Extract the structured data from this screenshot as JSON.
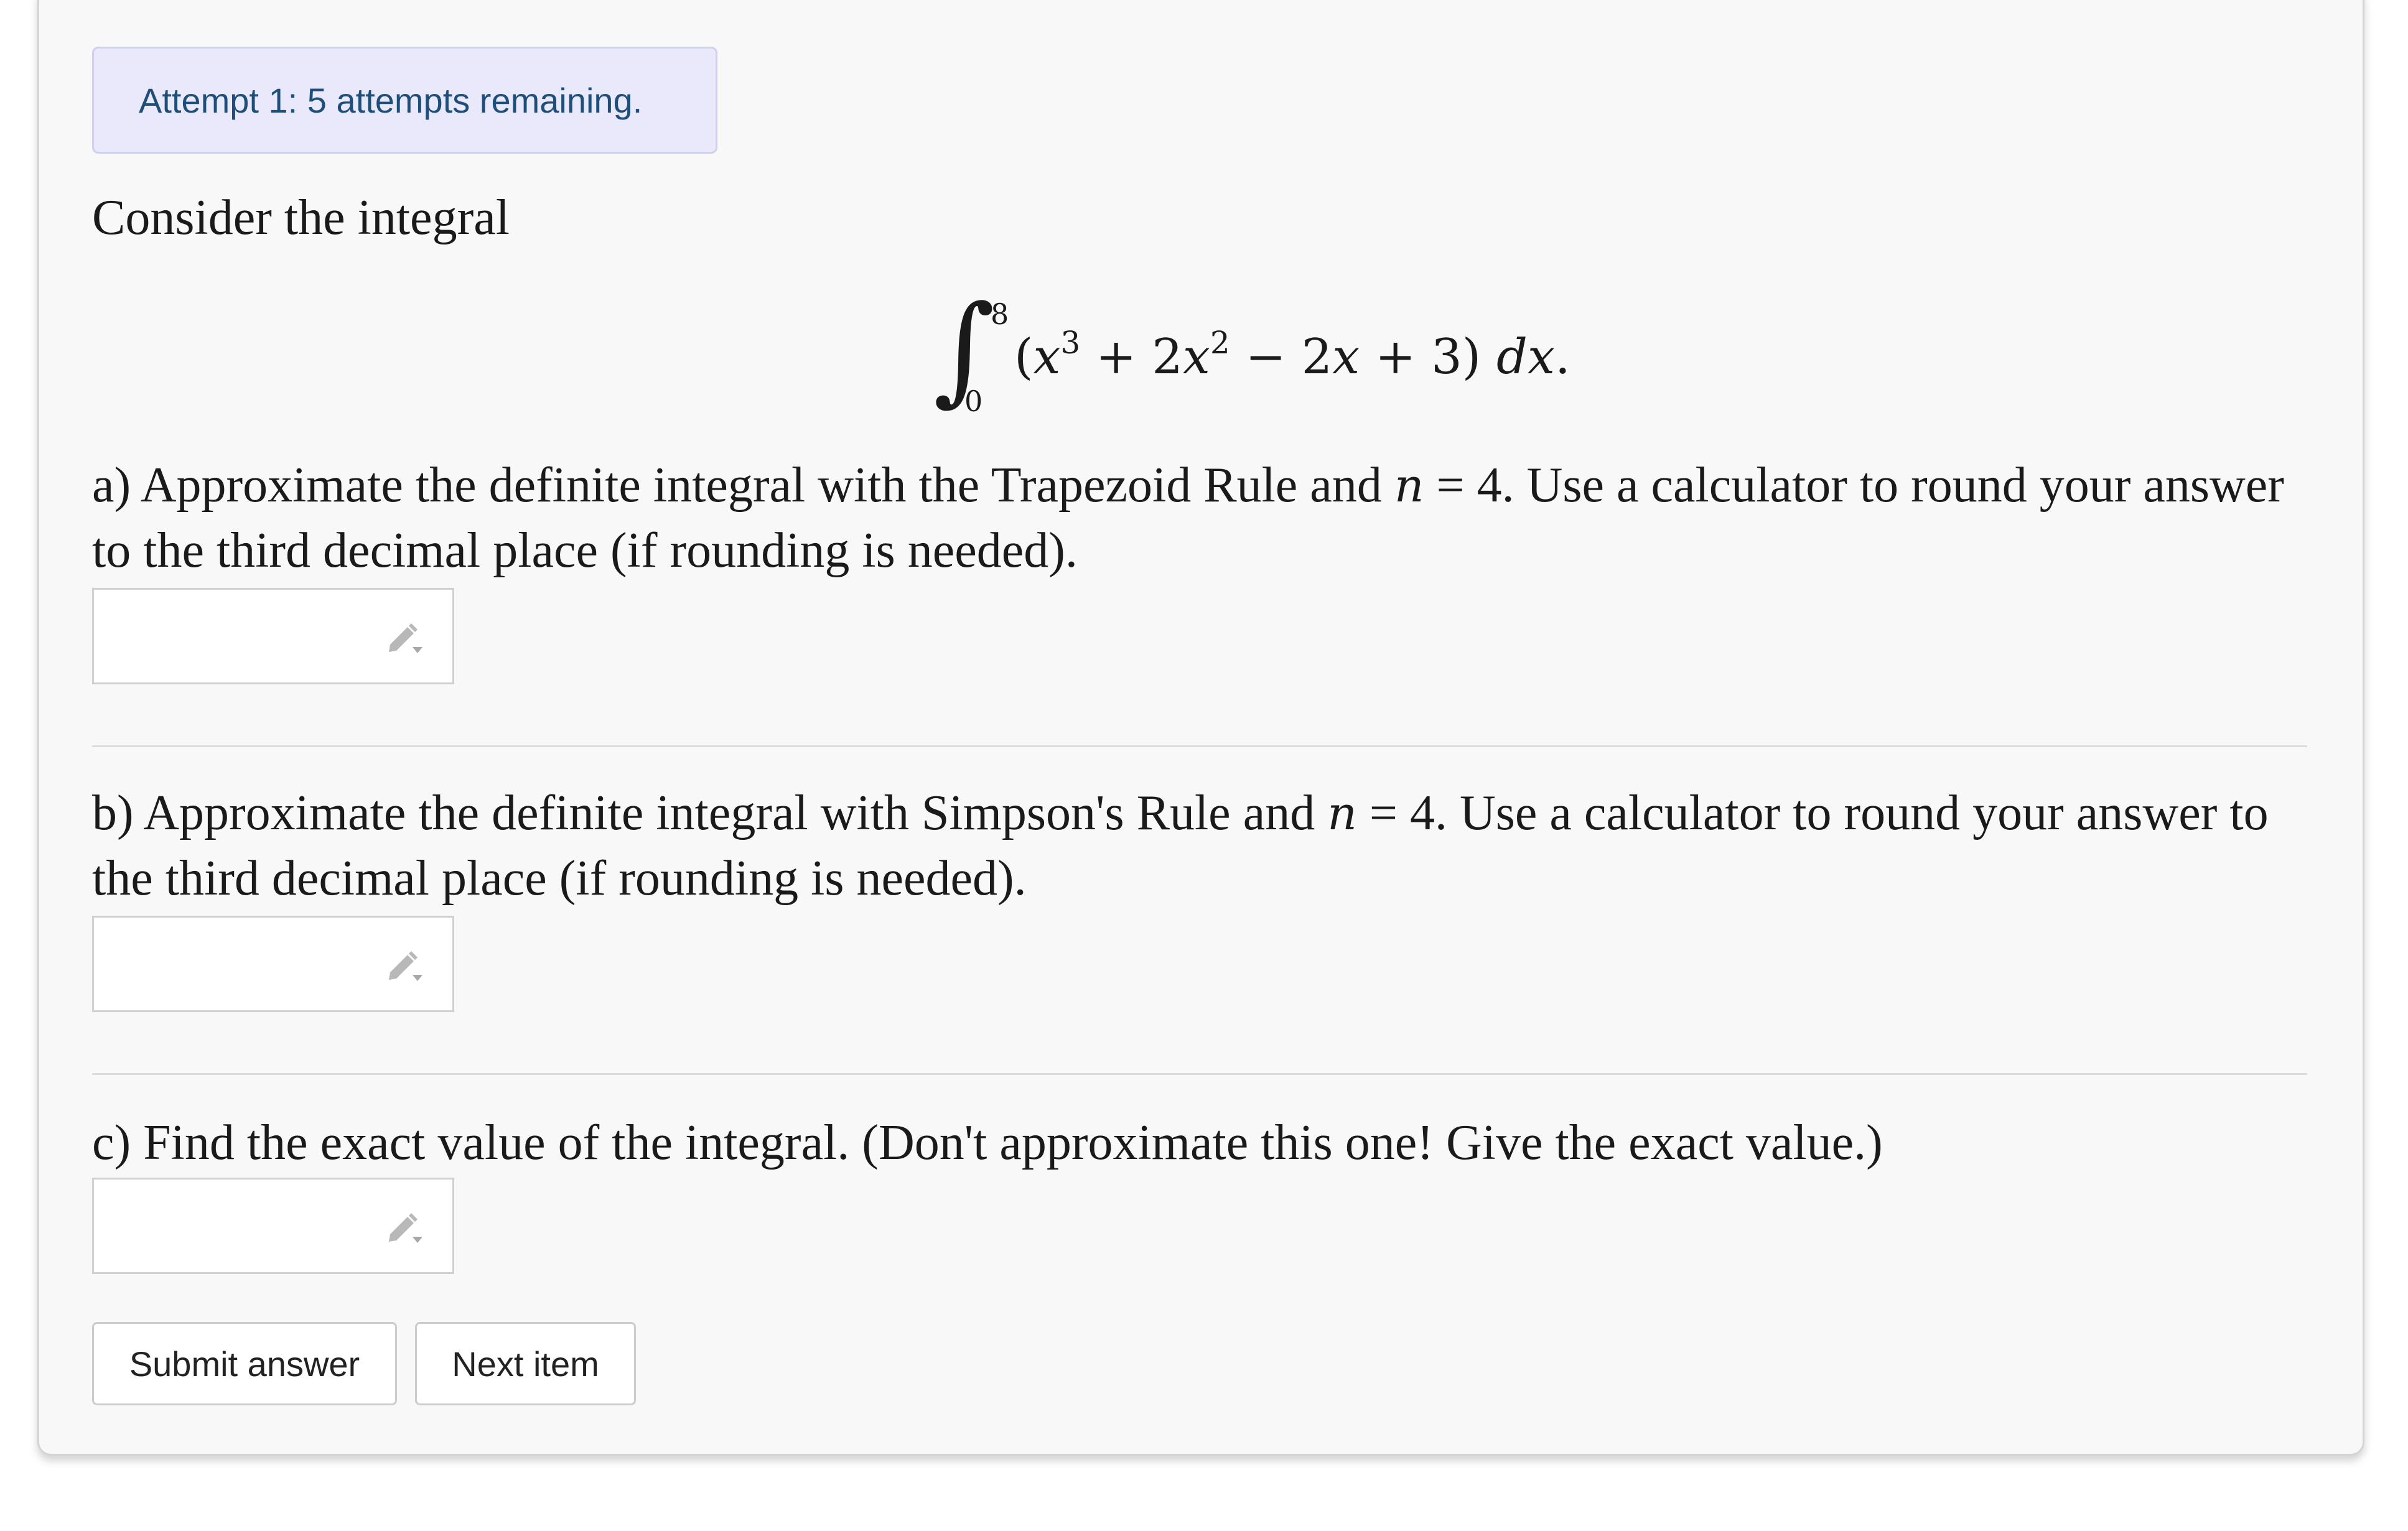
{
  "attempt_status": "Attempt 1: 5 attempts remaining.",
  "intro": "Consider the integral",
  "integral": {
    "lower_limit": "0",
    "upper_limit": "8",
    "integrand": "(x³ + 2x² − 2x + 3) dx."
  },
  "questions": [
    {
      "label": "a) Approximate the definite integral with the Trapezoid Rule and n = 4. Use a calculator to round your answer to the third decimal place (if rounding is needed).",
      "answer_value": ""
    },
    {
      "label": "b) Approximate the definite integral with Simpson's Rule and n = 4. Use a calculator to round your answer to the third decimal place (if rounding is needed).",
      "answer_value": ""
    },
    {
      "label": "c) Find the exact value of the integral. (Don't approximate this one! Give the exact value.)",
      "answer_value": ""
    }
  ],
  "buttons": {
    "submit": "Submit answer",
    "next": "Next item"
  },
  "icons": {
    "answer_tool": "pencil-dropdown-icon"
  },
  "colors": {
    "badge_bg": "#e9e9fb",
    "badge_text": "#1f4e79",
    "card_bg": "#f8f8f8"
  }
}
